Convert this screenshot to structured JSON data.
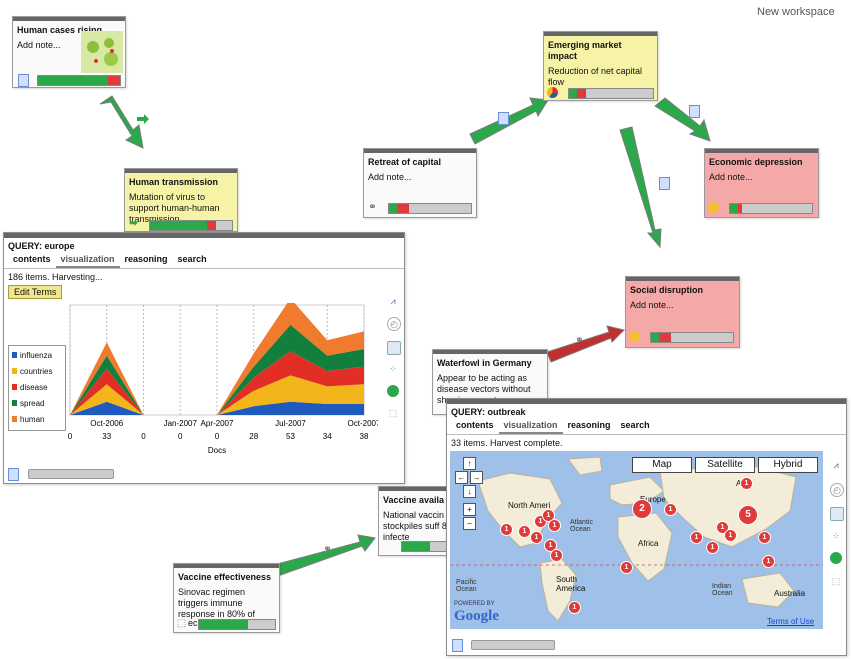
{
  "workspace_label": "New workspace",
  "cards": {
    "human_cases": {
      "title": "Human cases rising",
      "note": "Add note...",
      "progress": {
        "green": 0.85,
        "red": 0.15
      }
    },
    "human_transmission": {
      "title": "Human transmission",
      "note": "Mutation of virus to support human-human transmission",
      "progress": {
        "green": 0.7,
        "red": 0.1
      }
    },
    "emerging_market": {
      "title": "Emerging market impact",
      "note": "Reduction of net capital flow",
      "progress": {
        "green": 0.1,
        "red": 0.1
      }
    },
    "retreat_capital": {
      "title": "Retreat of capital",
      "note": "Add note...",
      "progress": {
        "green": 0.1,
        "red": 0.15
      }
    },
    "economic_depression": {
      "title": "Economic depression",
      "note": "Add note...",
      "progress": {
        "green": 0.1,
        "red": 0.05
      }
    },
    "social_disruption": {
      "title": "Social disruption",
      "note": "Add note...",
      "progress": {
        "green": 0.1,
        "red": 0.15
      }
    },
    "waterfowl": {
      "title": "Waterfowl in Germany",
      "note": "Appear to be acting as disease vectors without showing symptoms"
    },
    "vaccine_avail": {
      "title": "Vaccine availa",
      "note": "National vaccin stockpiles suff 80% of infecte"
    },
    "vaccine_effect": {
      "title": "Vaccine effectiveness",
      "note": "Sinovac regimen triggers immune response in 80% of",
      "note_tail": "ec"
    }
  },
  "query_europe": {
    "title": "QUERY: europe",
    "tabs": [
      "contents",
      "visualization",
      "reasoning",
      "search"
    ],
    "active_tab": "visualization",
    "status": "186 items. Harvesting...",
    "edit_button": "Edit Terms",
    "legend": [
      "influenza",
      "countries",
      "disease",
      "spread",
      "human"
    ]
  },
  "query_outbreak": {
    "title": "QUERY: outbreak",
    "tabs": [
      "contents",
      "visualization",
      "reasoning",
      "search"
    ],
    "active_tab": "visualization",
    "status": "33 items. Harvest complete.",
    "map_buttons": [
      "Map",
      "Satellite",
      "Hybrid"
    ],
    "labels": {
      "north_america": "North Ameri",
      "europe": "Europe",
      "asia": "Asi",
      "atlantic": "Atlantic Ocean",
      "africa": "Africa",
      "south_america": "South America",
      "indian": "Indian Ocean",
      "pacific": "Pacific Ocean",
      "australia": "Australia",
      "powered": "POWERED BY",
      "google": "Google",
      "terms": "Terms of Use"
    },
    "markers": [
      "1",
      "1",
      "1",
      "1",
      "1",
      "1",
      "1",
      "1",
      "5",
      "2",
      "1",
      "1",
      "1",
      "1",
      "1",
      "1",
      "1",
      "1",
      "1",
      "1"
    ]
  },
  "chart_data": {
    "type": "area",
    "title": "",
    "x": [
      "Oct-2006",
      "",
      "Jan-2007",
      "",
      "Apr-2007",
      "",
      "Jul-2007",
      "",
      "Oct-2007"
    ],
    "xticks": [
      "Oct-2006",
      "Jan-2007",
      "Apr-2007",
      "Jul-2007",
      "Oct-2007"
    ],
    "docs_counts": [
      "0",
      "33",
      "0",
      "0",
      "0",
      "28",
      "53",
      "34",
      "38"
    ],
    "xlabel": "Docs",
    "ylabel": "",
    "series": [
      {
        "name": "influenza",
        "color": "#1f5bbf",
        "values": [
          0,
          6,
          0,
          0,
          0,
          4,
          6,
          5,
          5
        ]
      },
      {
        "name": "countries",
        "color": "#f2b51a",
        "values": [
          0,
          8,
          0,
          0,
          0,
          7,
          12,
          8,
          9
        ]
      },
      {
        "name": "disease",
        "color": "#e22f25",
        "values": [
          0,
          7,
          0,
          0,
          0,
          6,
          11,
          7,
          8
        ]
      },
      {
        "name": "spread",
        "color": "#137f3d",
        "values": [
          0,
          6,
          0,
          0,
          0,
          5,
          12,
          7,
          8
        ]
      },
      {
        "name": "human",
        "color": "#f07a2d",
        "values": [
          0,
          6,
          0,
          0,
          0,
          6,
          12,
          7,
          8
        ]
      }
    ]
  }
}
